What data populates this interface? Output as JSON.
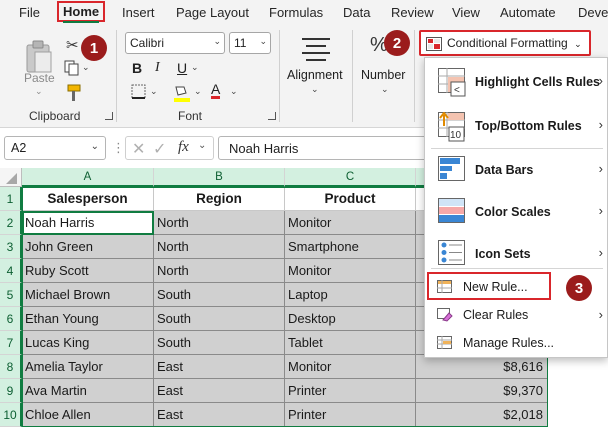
{
  "menu_tabs": [
    "File",
    "Home",
    "Insert",
    "Page Layout",
    "Formulas",
    "Data",
    "Review",
    "View",
    "Automate",
    "Deve"
  ],
  "ribbon": {
    "clipboard": {
      "paste_label": "Paste",
      "group_label": "Clipboard"
    },
    "font": {
      "font_name": "Calibri",
      "font_size": "11",
      "group_label": "Font",
      "bold": "B",
      "italic": "I",
      "underline": "U"
    },
    "alignment_label": "Alignment",
    "number_label": "Number",
    "conditional_formatting_label": "Conditional Formatting"
  },
  "badges": [
    "1",
    "2",
    "3"
  ],
  "formula_bar": {
    "name_box": "A2",
    "fx_symbol": "fx",
    "content": "Noah Harris"
  },
  "columns": [
    "A",
    "B",
    "C"
  ],
  "rows": [
    "1",
    "2",
    "3",
    "4",
    "5",
    "6",
    "7",
    "8",
    "9",
    "10"
  ],
  "table": {
    "headers": [
      "Salesperson",
      "Region",
      "Product"
    ],
    "rows": [
      [
        "Noah Harris",
        "North",
        "Monitor"
      ],
      [
        "John Green",
        "North",
        "Smartphone"
      ],
      [
        "Ruby Scott",
        "North",
        "Monitor"
      ],
      [
        "Michael Brown",
        "South",
        "Laptop"
      ],
      [
        "Ethan Young",
        "South",
        "Desktop"
      ],
      [
        "Lucas King",
        "South",
        "Tablet"
      ],
      [
        "Amelia Taylor",
        "East",
        "Monitor"
      ],
      [
        "Ava Martin",
        "East",
        "Printer"
      ],
      [
        "Chloe Allen",
        "East",
        "Printer"
      ]
    ],
    "sales_visible": [
      "",
      "",
      "",
      "",
      "",
      "",
      "$8,616",
      "$9,370",
      "$2,018"
    ]
  },
  "cf_menu": {
    "highlight_cells_rules": "Highlight Cells Rules",
    "top_bottom_rules": "Top/Bottom Rules",
    "data_bars": "Data Bars",
    "color_scales": "Color Scales",
    "icon_sets": "Icon Sets",
    "new_rule": "New Rule...",
    "clear_rules": "Clear Rules",
    "manage_rules": "Manage Rules..."
  },
  "colors": {
    "accent_green": "#107c41",
    "annotation_red": "#d9262b",
    "badge_fill": "#9b1c1c"
  }
}
